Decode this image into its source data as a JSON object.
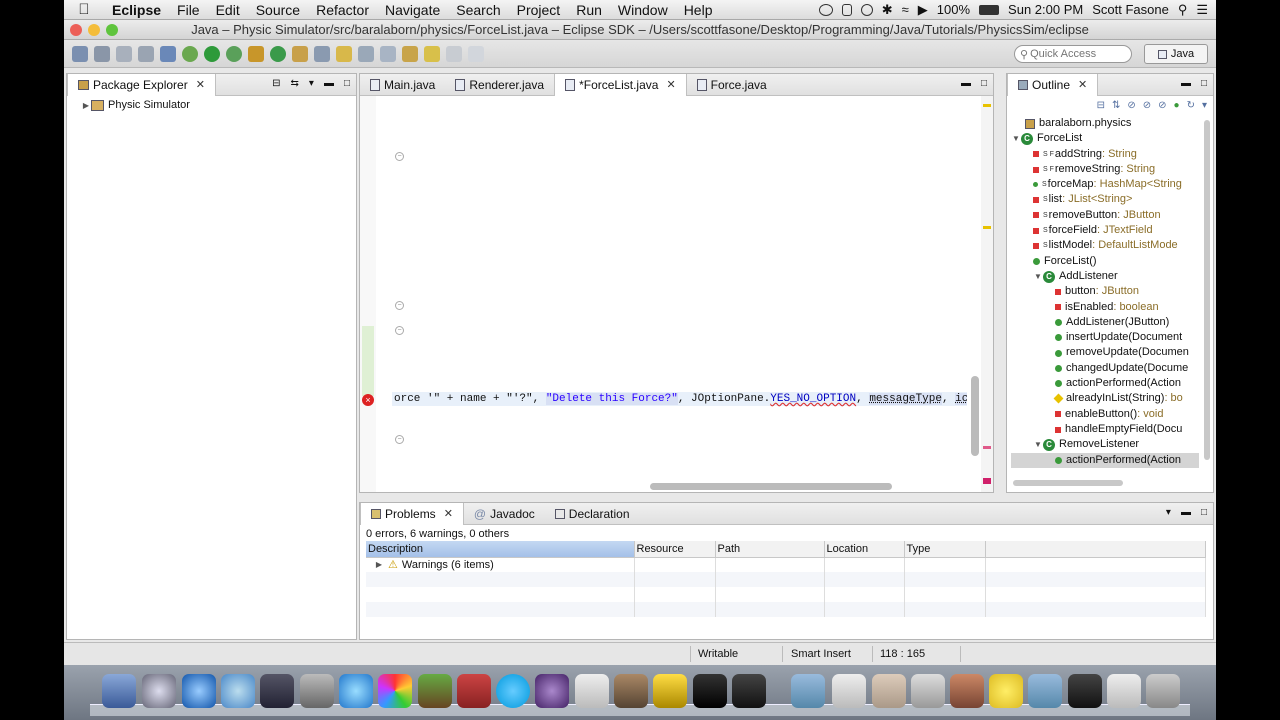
{
  "menubar": {
    "app": "Eclipse",
    "items": [
      "File",
      "Edit",
      "Source",
      "Refactor",
      "Navigate",
      "Search",
      "Project",
      "Run",
      "Window",
      "Help"
    ],
    "battery": "100%",
    "clock": "Sun 2:00 PM",
    "user": "Scott Fasone"
  },
  "window": {
    "title": "Java – Physic Simulator/src/baralaborn/physics/ForceList.java – Eclipse SDK – /Users/scottfasone/Desktop/Programming/Java/Tutorials/PhysicsSim/eclipse"
  },
  "toolbar": {
    "quick_access_placeholder": "Quick Access",
    "perspective": "Java"
  },
  "package_explorer": {
    "tab": "Package Explorer",
    "project": "Physic Simulator"
  },
  "editor": {
    "tabs": [
      "Main.java",
      "Renderer.java",
      "*ForceList.java",
      "Force.java"
    ],
    "active_tab": 2,
    "code": {
      "part1": "orce '\" + name + \"'?\", ",
      "str": "\"Delete this Force?\"",
      "part2": ", JOptionPane.",
      "field": "YES_NO_OPTION",
      "part3": ", ",
      "param1": "messageType",
      "part4": ", ",
      "param2": "icon",
      "part5": ","
    }
  },
  "outline": {
    "tab": "Outline",
    "package": "baralaborn.physics",
    "class": "ForceList",
    "members": [
      {
        "name": "addString",
        "type": " : String",
        "mod": "S F"
      },
      {
        "name": "removeString",
        "type": " : String",
        "mod": "S F"
      },
      {
        "name": "forceMap",
        "type": " : HashMap<String",
        "mod": "S"
      },
      {
        "name": "list",
        "type": " : JList<String>",
        "mod": "S"
      },
      {
        "name": "removeButton",
        "type": " : JButton",
        "mod": "S"
      },
      {
        "name": "forceField",
        "type": " : JTextField",
        "mod": "S"
      },
      {
        "name": "listModel",
        "type": " : DefaultListMode",
        "mod": "S"
      },
      {
        "name": "ForceList()",
        "type": "",
        "mod": ""
      }
    ],
    "addlistener": {
      "name": "AddListener",
      "members": [
        {
          "name": "button",
          "type": " : JButton"
        },
        {
          "name": "isEnabled",
          "type": " : boolean"
        },
        {
          "name": "AddListener(JButton)",
          "type": ""
        },
        {
          "name": "insertUpdate(Document",
          "type": ""
        },
        {
          "name": "removeUpdate(Documen",
          "type": ""
        },
        {
          "name": "changedUpdate(Docume",
          "type": ""
        },
        {
          "name": "actionPerformed(Action",
          "type": ""
        },
        {
          "name": "alreadyInList(String)",
          "type": " : bo"
        },
        {
          "name": "enableButton()",
          "type": " : void"
        },
        {
          "name": "handleEmptyField(Docu",
          "type": ""
        }
      ]
    },
    "removelistener": {
      "name": "RemoveListener",
      "members": [
        {
          "name": "actionPerformed(Action",
          "type": ""
        }
      ]
    }
  },
  "problems": {
    "tabs": [
      "Problems",
      "Javadoc",
      "Declaration"
    ],
    "summary": "0 errors, 6 warnings, 0 others",
    "columns": [
      "Description",
      "Resource",
      "Path",
      "Location",
      "Type"
    ],
    "warnings_row": "Warnings (6 items)"
  },
  "status": {
    "writable": "Writable",
    "insert_mode": "Smart Insert",
    "position": "118 : 165"
  },
  "colors": {
    "accent": "#3875d7",
    "error": "#d22222",
    "warning": "#e8c200"
  }
}
